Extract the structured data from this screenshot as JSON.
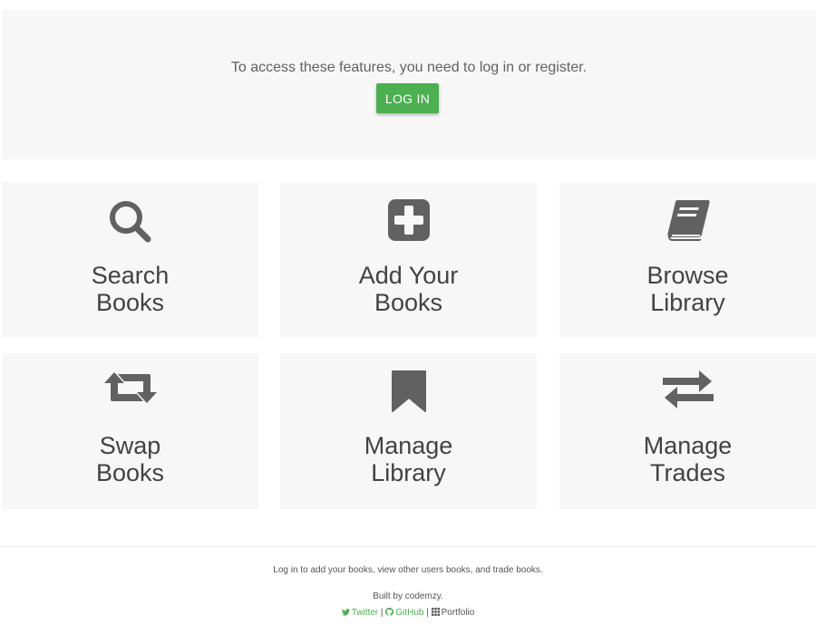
{
  "hero": {
    "message": "To access these features, you need to log in or register.",
    "login_label": "LOG IN"
  },
  "cards": [
    {
      "icon": "search-icon",
      "line1": "Search",
      "line2": "Books"
    },
    {
      "icon": "plus-square-icon",
      "line1": "Add Your",
      "line2": "Books"
    },
    {
      "icon": "book-icon",
      "line1": "Browse",
      "line2": "Library"
    },
    {
      "icon": "retweet-icon",
      "line1": "Swap",
      "line2": "Books"
    },
    {
      "icon": "bookmark-icon",
      "line1": "Manage",
      "line2": "Library"
    },
    {
      "icon": "exchange-icon",
      "line1": "Manage",
      "line2": "Trades"
    }
  ],
  "footer": {
    "description": "Log in to add your books, view other users books, and trade books.",
    "built_by": "Built by codemzy.",
    "links": {
      "twitter": "Twitter",
      "separator": "|",
      "github": "GitHub",
      "portfolio": "Portfolio"
    }
  },
  "colors": {
    "accent": "#4caf50",
    "card_bg": "#f7f7f7",
    "icon": "#616161",
    "text": "#424242"
  }
}
